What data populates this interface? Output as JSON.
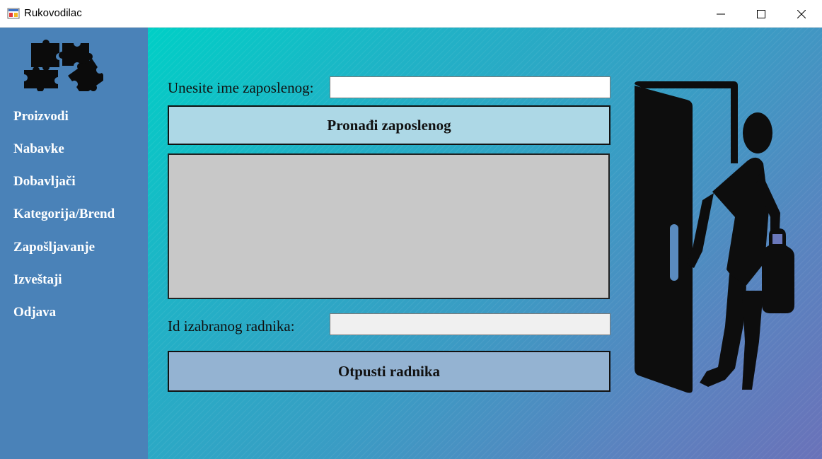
{
  "window": {
    "title": "Rukovodilac"
  },
  "sidebar": {
    "items": [
      {
        "label": "Proizvodi"
      },
      {
        "label": "Nabavke"
      },
      {
        "label": "Dobavljači"
      },
      {
        "label": "Kategorija/Brend"
      },
      {
        "label": "Zapošljavanje"
      },
      {
        "label": "Izveštaji"
      },
      {
        "label": "Odjava"
      }
    ]
  },
  "search": {
    "label": "Unesite ime zaposlenog:",
    "value": "",
    "button_label": "Pronađi zaposlenog"
  },
  "selection": {
    "label": "Id izabranog radnika:",
    "value": ""
  },
  "fire": {
    "button_label": "Otpusti radnika"
  },
  "icons": {
    "app": "app-window-icon",
    "logo": "puzzle-pieces-icon",
    "illustration": "person-leaving-door-icon"
  },
  "colors": {
    "sidebar": "#4a82b8",
    "find_button": "#add8e6",
    "fire_button": "#94b3d2",
    "grid": "#c8c8c8",
    "gradient_start": "#00cfc6",
    "gradient_end": "#6a72b9"
  }
}
